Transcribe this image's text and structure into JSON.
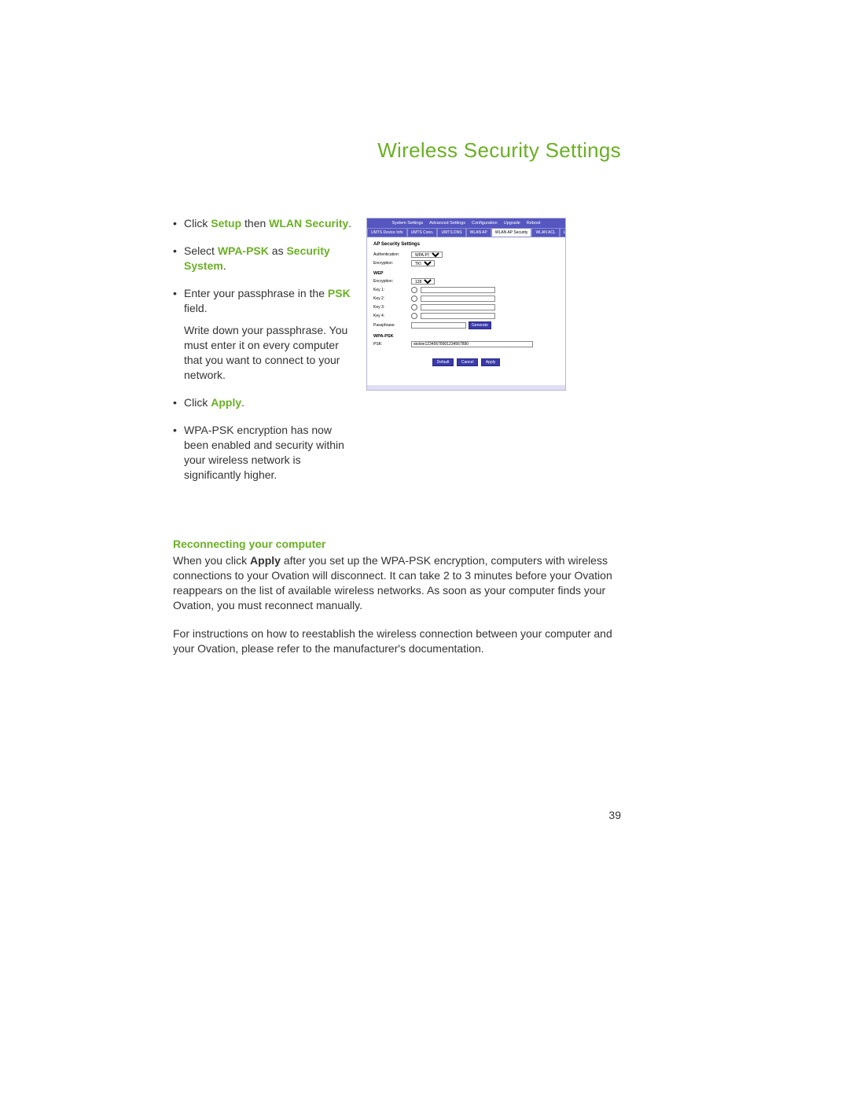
{
  "page": {
    "title": "Wireless Security Settings",
    "number": "39"
  },
  "steps": {
    "s1_a": "Click ",
    "s1_b": "Setup",
    "s1_c": " then ",
    "s1_d": "WLAN Security",
    "s1_e": ".",
    "s2_a": "Select ",
    "s2_b": "WPA-PSK",
    "s2_c": " as ",
    "s2_d": "Security System",
    "s2_e": ".",
    "s3_a": "Enter your passphrase in the ",
    "s3_b": "PSK",
    "s3_c": " field.",
    "s3_note": "Write down your passphrase. You must enter it on every computer that you want to connect to your network.",
    "s4_a": "Click ",
    "s4_b": "Apply",
    "s4_c": ".",
    "s5": "WPA-PSK encryption has now been enabled and security within your wireless network is significantly higher."
  },
  "fig": {
    "nav": {
      "a": "System Settings",
      "b": "Advanced Settings",
      "c": "Configuration",
      "d": "Upgrade",
      "e": "Reboot"
    },
    "tabs": {
      "a": "UMTS Device Info",
      "b": "UMTS Conn.",
      "c": "UMTS DNS",
      "d": "WLAN AP",
      "e": "WLAN AP Security",
      "f": "WLAN ACL",
      "g": "LAN"
    },
    "heading": "AP Security Settings",
    "auth_label": "Authentication:",
    "auth_value": "WPA-PSK",
    "enc_label": "Encryption:",
    "enc_value": "TKIP",
    "wep_heading": "WEP",
    "wep_enc_label": "Encryption:",
    "wep_enc_value": "128 bit",
    "key1": "Key 1:",
    "key2": "Key 2:",
    "key3": "Key 3:",
    "key4": "Key 4:",
    "passphrase_label": "Passphrase:",
    "generate": "Generate",
    "wpa_heading": "WPA-PSK",
    "psk_label": "PSK:",
    "psk_value": "skdoie12345678901234567890",
    "btn_default": "Default",
    "btn_cancel": "Cancel",
    "btn_apply": "Apply"
  },
  "reconnect": {
    "heading": "Reconnecting your computer",
    "p1a": "When you click ",
    "p1b": "Apply",
    "p1c": " after you set up the WPA-PSK encryption, computers with wireless connections to your Ovation will disconnect. It can take 2 to 3 minutes before your Ovation reappears on the list of available wireless networks. As soon as your computer finds your Ovation, you must reconnect manually.",
    "p2": "For instructions on how to reestablish the wireless connection between your computer and your Ovation, please refer to the manufacturer's documentation."
  }
}
